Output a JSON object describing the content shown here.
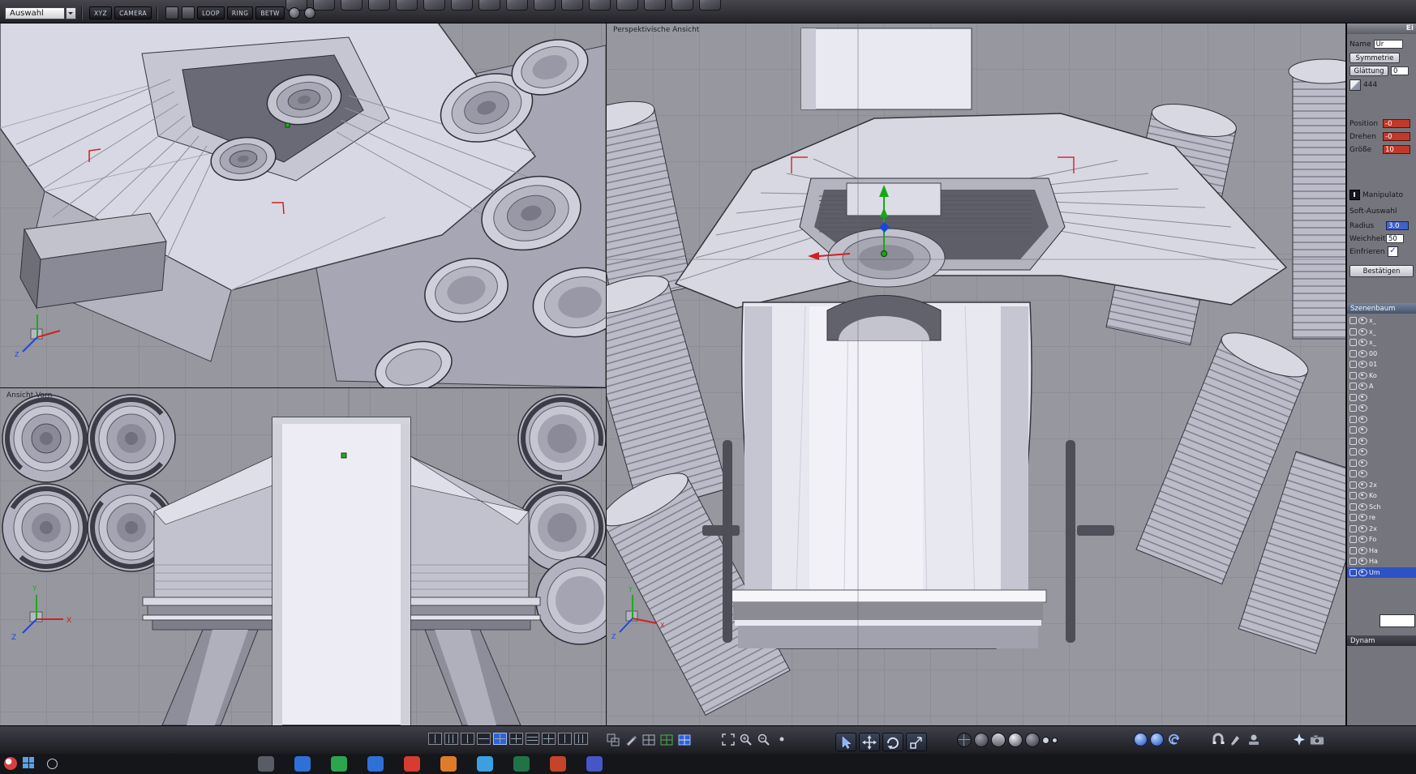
{
  "colors": {
    "selection_blue": "#2d52c4",
    "accent_blue": "#2d62d8",
    "field_red": "#c0392b",
    "axis_x": "#cc2222",
    "axis_y": "#1faa1f",
    "axis_z": "#2244dd",
    "viewport_bg": "#97979f"
  },
  "top_toolbar": {
    "auswahl": "Auswahl",
    "xyz": "XYZ",
    "camera": "CAMERA",
    "loop": "LOOP",
    "ring": "RING",
    "betw": "BETW",
    "big_icons": [
      {
        "name": "modeling-tool-icon"
      },
      {
        "name": "modeling-tool-icon"
      },
      {
        "name": "modeling-tool-icon"
      },
      {
        "name": "modeling-tool-icon"
      },
      {
        "name": "modeling-tool-icon"
      },
      {
        "name": "modeling-tool-icon"
      },
      {
        "name": "modeling-tool-icon"
      },
      {
        "name": "modeling-tool-icon"
      },
      {
        "name": "modeling-tool-icon"
      },
      {
        "name": "modeling-tool-icon"
      },
      {
        "name": "modeling-tool-icon"
      },
      {
        "name": "modeling-tool-icon"
      },
      {
        "name": "modeling-tool-icon"
      },
      {
        "name": "modeling-tool-icon"
      },
      {
        "name": "modeling-tool-icon"
      },
      {
        "name": "modeling-tool-icon"
      }
    ]
  },
  "viewports": {
    "front": {
      "label": "Ansicht Vorn"
    },
    "perspective": {
      "label": "Perspektivische Ansicht"
    },
    "axis": {
      "x": "X",
      "y": "Y",
      "z": "Z"
    }
  },
  "properties": {
    "panel_title": "Ei",
    "name_label": "Name",
    "name_value": "Ur",
    "symmetrie": "Symmetrie",
    "glaettung": "Glättung",
    "glaettung_value": "0",
    "object_id": "444",
    "position_label": "Position",
    "position_value": "-0",
    "drehen_label": "Drehen",
    "drehen_value": "-0",
    "groesse_label": "Größe",
    "groesse_value": "10",
    "manipulator_label": "Manipulato",
    "soft_label": "Soft-Auswahl",
    "radius_label": "Radius",
    "radius_value": "3.0",
    "weichheit_label": "Weichheit",
    "weichheit_value": "50",
    "einfrieren_label": "Einfrieren",
    "einfrieren_checked": "✓",
    "bestaetigen": "Bestätigen"
  },
  "scene_tree": {
    "title": "Szenenbaum",
    "footer": "Dynam",
    "items": [
      {
        "label": "x_"
      },
      {
        "label": "x_"
      },
      {
        "label": "x_"
      },
      {
        "label": "00"
      },
      {
        "label": "01"
      },
      {
        "label": "Ko"
      },
      {
        "label": "A"
      },
      {
        "label": ""
      },
      {
        "label": ""
      },
      {
        "label": ""
      },
      {
        "label": ""
      },
      {
        "label": ""
      },
      {
        "label": ""
      },
      {
        "label": ""
      },
      {
        "label": ""
      },
      {
        "label": "2x"
      },
      {
        "label": "Ko"
      },
      {
        "label": "Sch"
      },
      {
        "label": "re"
      },
      {
        "label": "2x"
      },
      {
        "label": "Fo"
      },
      {
        "label": "Ha"
      },
      {
        "label": "Ha"
      },
      {
        "label": "Um",
        "selected": true
      }
    ]
  },
  "bottom_toolbar": {
    "layout_icons": [
      {
        "name": "layout-2col-icon",
        "variant": "p-v"
      },
      {
        "name": "layout-3col-icon",
        "variant": "p-v3"
      },
      {
        "name": "layout-2col-b-icon",
        "variant": "p-v"
      },
      {
        "name": "layout-2row-icon",
        "variant": "p-h"
      },
      {
        "name": "layout-quad-icon",
        "variant": "p-vh",
        "selected": true
      },
      {
        "name": "layout-quad-b-icon",
        "variant": "p-vh"
      },
      {
        "name": "layout-3row-icon",
        "variant": "p-h3"
      },
      {
        "name": "layout-quad-c-icon",
        "variant": "p-vh"
      },
      {
        "name": "layout-2col-c-icon",
        "variant": "p-v"
      },
      {
        "name": "layout-4col-icon",
        "variant": "p-v3"
      }
    ],
    "edit_icons": [
      "uv-grid-icon",
      "paint-icon",
      "grid-icon",
      "snap-grid-icon",
      "table-grid-icon"
    ],
    "zoom_icons": [
      "fit-view-icon",
      "zoom-in-icon",
      "zoom-out-icon",
      "pan-dot-icon"
    ],
    "transform_icons": [
      "select-arrow-icon",
      "move-tool-icon",
      "rotate-tool-icon",
      "scale-tool-icon"
    ],
    "display_icons": [
      {
        "name": "wireframe-mode-icon",
        "variant": "wire"
      },
      {
        "name": "hiddenline-mode-icon",
        "variant": "dark"
      },
      {
        "name": "flat-mode-icon",
        "variant": "flat"
      },
      {
        "name": "smooth-mode-icon",
        "variant": "smooth"
      },
      {
        "name": "textured-mode-icon",
        "variant": "dark"
      },
      {
        "name": "points-mode-icon",
        "variant": "dot"
      },
      {
        "name": "small-points-mode-icon",
        "variant": "dot sm"
      }
    ],
    "shade_icons": [
      "material-sphere-icon",
      "env-sphere-icon",
      "swirl-icon"
    ],
    "brush_icons": [
      "magnet-tool-icon",
      "brush-tool-icon",
      "stamp-tool-icon"
    ],
    "render_icons": [
      "sparkle-icon",
      "camera-icon"
    ]
  },
  "taskbar": {
    "apps": [
      {
        "name": "taskbar-app-icon",
        "color": "#585c64"
      },
      {
        "name": "taskbar-app-icon",
        "color": "#2f6fd8"
      },
      {
        "name": "taskbar-app-icon",
        "color": "#2da44e"
      },
      {
        "name": "taskbar-app-icon",
        "color": "#2f6fd8"
      },
      {
        "name": "taskbar-app-icon",
        "color": "#d83b2f"
      },
      {
        "name": "taskbar-app-icon",
        "color": "#e07b2a"
      },
      {
        "name": "taskbar-app-icon",
        "color": "#3aa0e0"
      },
      {
        "name": "taskbar-app-icon",
        "color": "#217346"
      },
      {
        "name": "taskbar-app-icon",
        "color": "#c4432a"
      },
      {
        "name": "taskbar-app-icon",
        "color": "#4656c8"
      }
    ]
  }
}
